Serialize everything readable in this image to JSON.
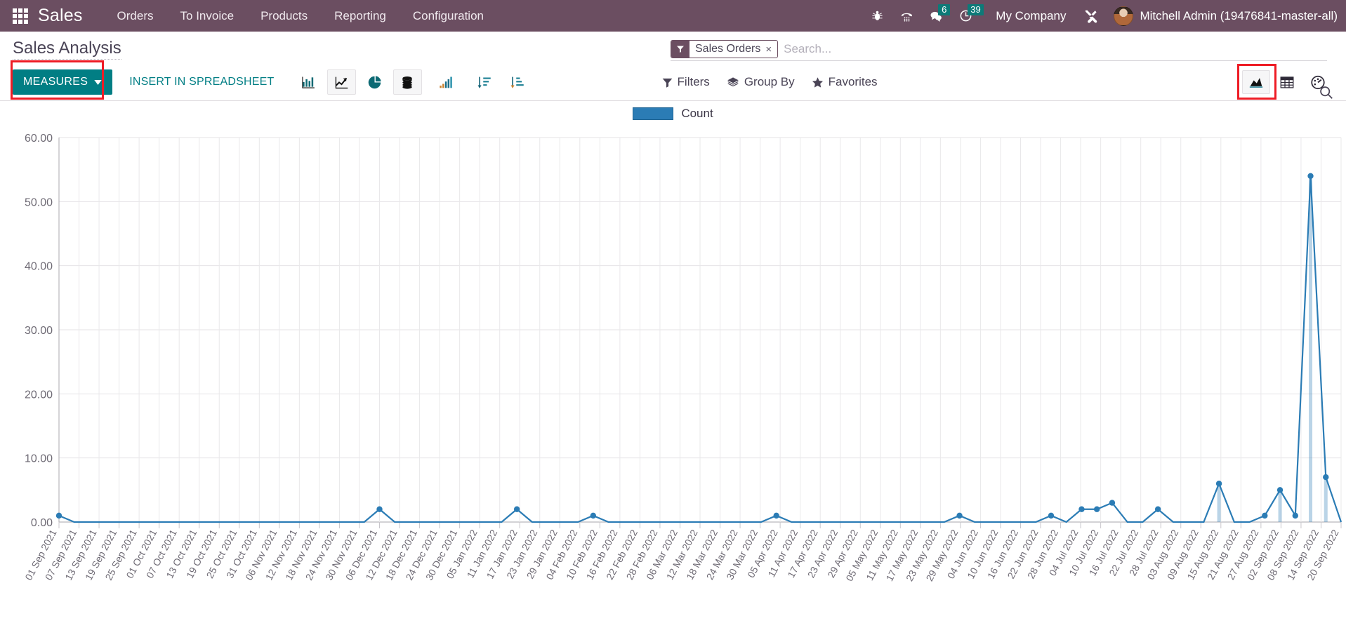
{
  "navbar": {
    "apps_icon": "apps-grid-icon",
    "brand": "Sales",
    "menu": [
      "Orders",
      "To Invoice",
      "Products",
      "Reporting",
      "Configuration"
    ],
    "sys_icons": [
      {
        "name": "bug-icon",
        "glyph": "🐞",
        "badge": null
      },
      {
        "name": "voip-dialpad-icon",
        "glyph": "☎",
        "badge": null
      },
      {
        "name": "messages-icon",
        "glyph": "💬",
        "badge": "6"
      },
      {
        "name": "activities-clock-icon",
        "glyph": "🕓",
        "badge": "39"
      }
    ],
    "company": "My Company",
    "debug_icon": "tools-wrench-icon",
    "avatar": "user-avatar",
    "user": "Mitchell Admin (19476841-master-all)",
    "bg_color": "#6b4e61",
    "badge_color": "#0d7a78"
  },
  "control_panel": {
    "title": "Sales Analysis",
    "search": {
      "facet_icon": "filter-funnel-icon",
      "facet_label": "Sales Orders",
      "facet_remove": "×",
      "placeholder": "Search...",
      "value": "",
      "magnifier_icon": "search-icon"
    },
    "measures_label": "MEASURES",
    "measures_color": "#017e84",
    "highlight_color": "#ee1c25",
    "insert_spreadsheet_label": "INSERT IN SPREADSHEET",
    "chart_tools": [
      {
        "name": "bar-chart-icon",
        "active": false
      },
      {
        "name": "line-chart-icon",
        "active": true
      },
      {
        "name": "pie-chart-icon",
        "active": false
      },
      {
        "name": "stacked-database-icon",
        "active": true
      },
      {
        "name": "ascending-bars-icon",
        "active": false
      },
      {
        "name": "sort-descending-icon",
        "active": false
      },
      {
        "name": "sort-ascending-icon",
        "active": false
      }
    ],
    "filters": [
      {
        "name": "filters-button",
        "label": "Filters",
        "icon": "funnel-icon"
      },
      {
        "name": "group-by-button",
        "label": "Group By",
        "icon": "layers-icon"
      },
      {
        "name": "favorites-button",
        "label": "Favorites",
        "icon": "star-icon"
      }
    ],
    "views": [
      {
        "name": "graph-view-button",
        "icon": "area-chart-icon",
        "active": true,
        "highlighted": true
      },
      {
        "name": "pivot-view-button",
        "icon": "table-grid-icon",
        "active": false,
        "highlighted": false
      },
      {
        "name": "cohort-view-button",
        "icon": "gauge-dashboard-icon",
        "active": false,
        "highlighted": false
      }
    ]
  },
  "chart_data": {
    "type": "line",
    "title": "",
    "xlabel": "",
    "ylabel": "",
    "ylim": [
      0,
      60
    ],
    "ytick_labels": [
      "0.00",
      "10.00",
      "20.00",
      "30.00",
      "40.00",
      "50.00",
      "60.00"
    ],
    "yticks": [
      0,
      10,
      20,
      30,
      40,
      50,
      60
    ],
    "grid": true,
    "legend_position": "top-center",
    "series": [
      {
        "name": "Count",
        "color": "#2b7cb5",
        "values": [
          1,
          0,
          0,
          0,
          0,
          0,
          0,
          0,
          0,
          0,
          0,
          0,
          0,
          0,
          0,
          0,
          0,
          0,
          0,
          0,
          0,
          2,
          0,
          0,
          0,
          0,
          0,
          0,
          0,
          0,
          2,
          0,
          0,
          0,
          0,
          1,
          0,
          0,
          0,
          0,
          0,
          0,
          0,
          0,
          0,
          0,
          0,
          1,
          0,
          0,
          0,
          0,
          0,
          0,
          0,
          0,
          0,
          0,
          0,
          1,
          0,
          0,
          0,
          0,
          0,
          1,
          0,
          2,
          2,
          3,
          0,
          0,
          2,
          0,
          0,
          0,
          6,
          0,
          0,
          1,
          5,
          1,
          54,
          7,
          0
        ]
      }
    ],
    "categories": [
      "01 Sep 2021",
      "07 Sep 2021",
      "13 Sep 2021",
      "19 Sep 2021",
      "25 Sep 2021",
      "01 Oct 2021",
      "07 Oct 2021",
      "13 Oct 2021",
      "19 Oct 2021",
      "25 Oct 2021",
      "31 Oct 2021",
      "06 Nov 2021",
      "12 Nov 2021",
      "18 Nov 2021",
      "24 Nov 2021",
      "30 Nov 2021",
      "06 Dec 2021",
      "12 Dec 2021",
      "18 Dec 2021",
      "24 Dec 2021",
      "30 Dec 2021",
      "05 Jan 2022",
      "11 Jan 2022",
      "17 Jan 2022",
      "23 Jan 2022",
      "29 Jan 2022",
      "04 Feb 2022",
      "10 Feb 2022",
      "16 Feb 2022",
      "22 Feb 2022",
      "28 Feb 2022",
      "06 Mar 2022",
      "12 Mar 2022",
      "18 Mar 2022",
      "24 Mar 2022",
      "30 Mar 2022",
      "05 Apr 2022",
      "11 Apr 2022",
      "17 Apr 2022",
      "23 Apr 2022",
      "29 Apr 2022",
      "05 May 2022",
      "11 May 2022",
      "17 May 2022",
      "23 May 2022",
      "29 May 2022",
      "04 Jun 2022",
      "10 Jun 2022",
      "16 Jun 2022",
      "22 Jun 2022",
      "28 Jun 2022",
      "04 Jul 2022",
      "10 Jul 2022",
      "16 Jul 2022",
      "22 Jul 2022",
      "28 Jul 2022",
      "03 Aug 2022",
      "09 Aug 2022",
      "15 Aug 2022",
      "21 Aug 2022",
      "27 Aug 2022",
      "02 Sep 2022",
      "08 Sep 2022",
      "14 Sep 2022",
      "20 Sep 2022"
    ],
    "legend": [
      {
        "label": "Count",
        "color": "#2b7cb5"
      }
    ]
  }
}
